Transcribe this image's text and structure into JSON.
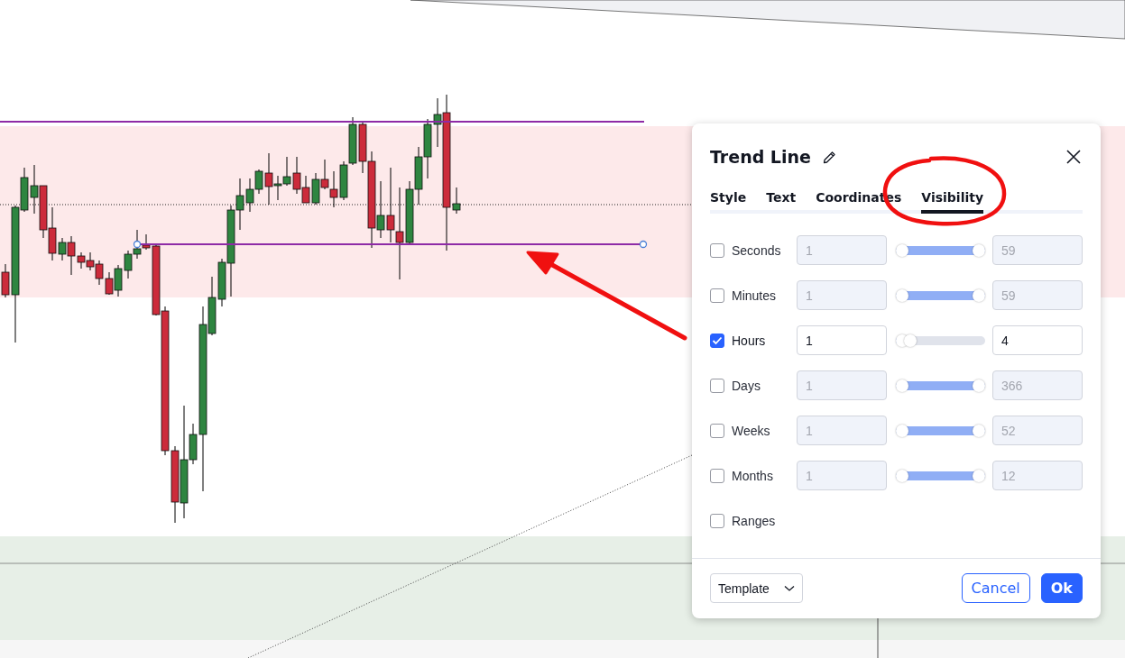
{
  "dialog": {
    "title": "Trend Line",
    "tabs": [
      {
        "label": "Style",
        "selected": false
      },
      {
        "label": "Text",
        "selected": false
      },
      {
        "label": "Coordinates",
        "selected": false
      },
      {
        "label": "Visibility",
        "selected": true
      }
    ],
    "rows": [
      {
        "kind": "range",
        "label": "Seconds",
        "checked": false,
        "from": "1",
        "to": "59",
        "level": 1
      },
      {
        "kind": "range",
        "label": "Minutes",
        "checked": false,
        "from": "1",
        "to": "59",
        "level": 1
      },
      {
        "kind": "range",
        "label": "Hours",
        "checked": true,
        "from": "1",
        "to": "4",
        "level": 0.1
      },
      {
        "kind": "range",
        "label": "Days",
        "checked": false,
        "from": "1",
        "to": "366",
        "level": 1
      },
      {
        "kind": "range",
        "label": "Weeks",
        "checked": false,
        "from": "1",
        "to": "52",
        "level": 1
      },
      {
        "kind": "range",
        "label": "Months",
        "checked": false,
        "from": "1",
        "to": "12",
        "level": 1
      },
      {
        "kind": "plain",
        "label": "Ranges",
        "checked": false
      }
    ],
    "template": "Template",
    "buttons": [
      {
        "label": "Cancel",
        "kind": "secondary"
      },
      {
        "label": "Ok",
        "kind": "primary"
      }
    ]
  }
}
